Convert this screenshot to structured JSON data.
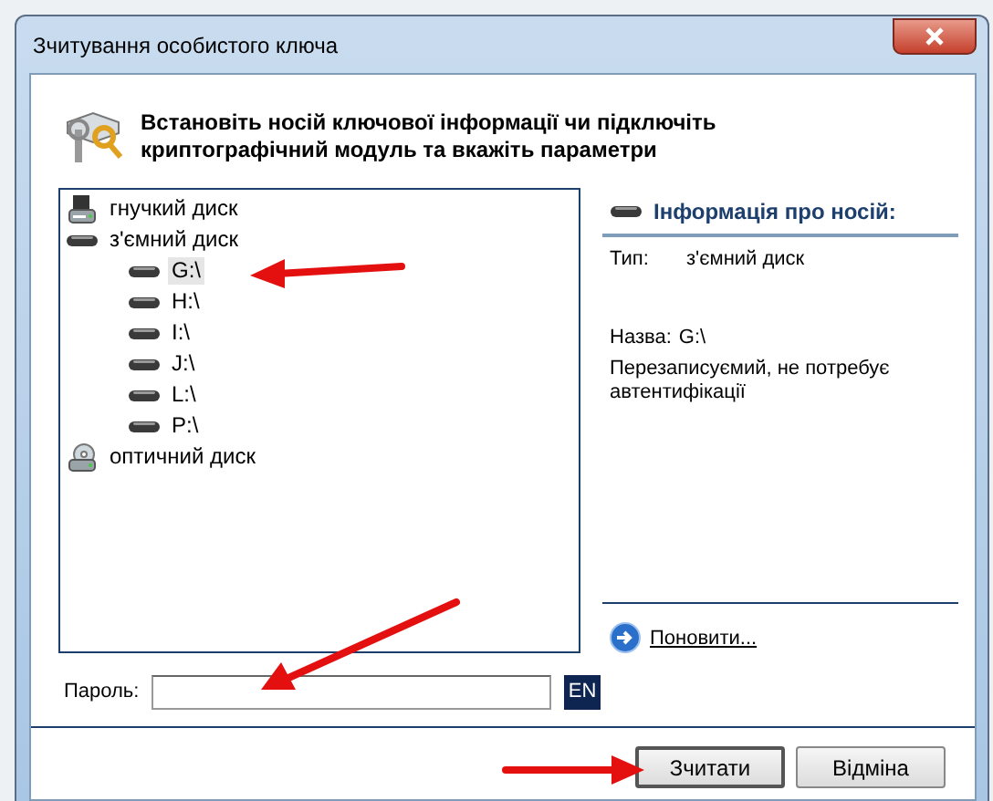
{
  "window": {
    "title": "Зчитування особистого ключа"
  },
  "header": {
    "text": "Встановіть носій ключової інформації чи підключіть криптографічний модуль та вкажіть параметри"
  },
  "tree": [
    {
      "label": "гнучкий диск",
      "kind": "floppy",
      "selected": false
    },
    {
      "label": "з'ємний диск",
      "kind": "removable",
      "selected": false,
      "children": [
        {
          "label": "G:\\",
          "kind": "removable",
          "selected": true
        },
        {
          "label": "H:\\",
          "kind": "removable",
          "selected": false
        },
        {
          "label": "I:\\",
          "kind": "removable",
          "selected": false
        },
        {
          "label": "J:\\",
          "kind": "removable",
          "selected": false
        },
        {
          "label": "L:\\",
          "kind": "removable",
          "selected": false
        },
        {
          "label": "P:\\",
          "kind": "removable",
          "selected": false
        }
      ]
    },
    {
      "label": "оптичний диск",
      "kind": "optical",
      "selected": false
    }
  ],
  "info": {
    "title": "Інформація про носій:",
    "type_label": "Тип:",
    "type_value": "з'ємний диск",
    "name_label": "Назва:",
    "name_value": "G:\\",
    "description": "Перезаписуємий, не потребує автентифікації",
    "refresh_link": "Поновити..."
  },
  "password": {
    "label": "Пароль:",
    "language": "EN"
  },
  "buttons": [
    {
      "label": "Зчитати",
      "default": true
    },
    {
      "label": "Відміна",
      "default": false
    }
  ]
}
